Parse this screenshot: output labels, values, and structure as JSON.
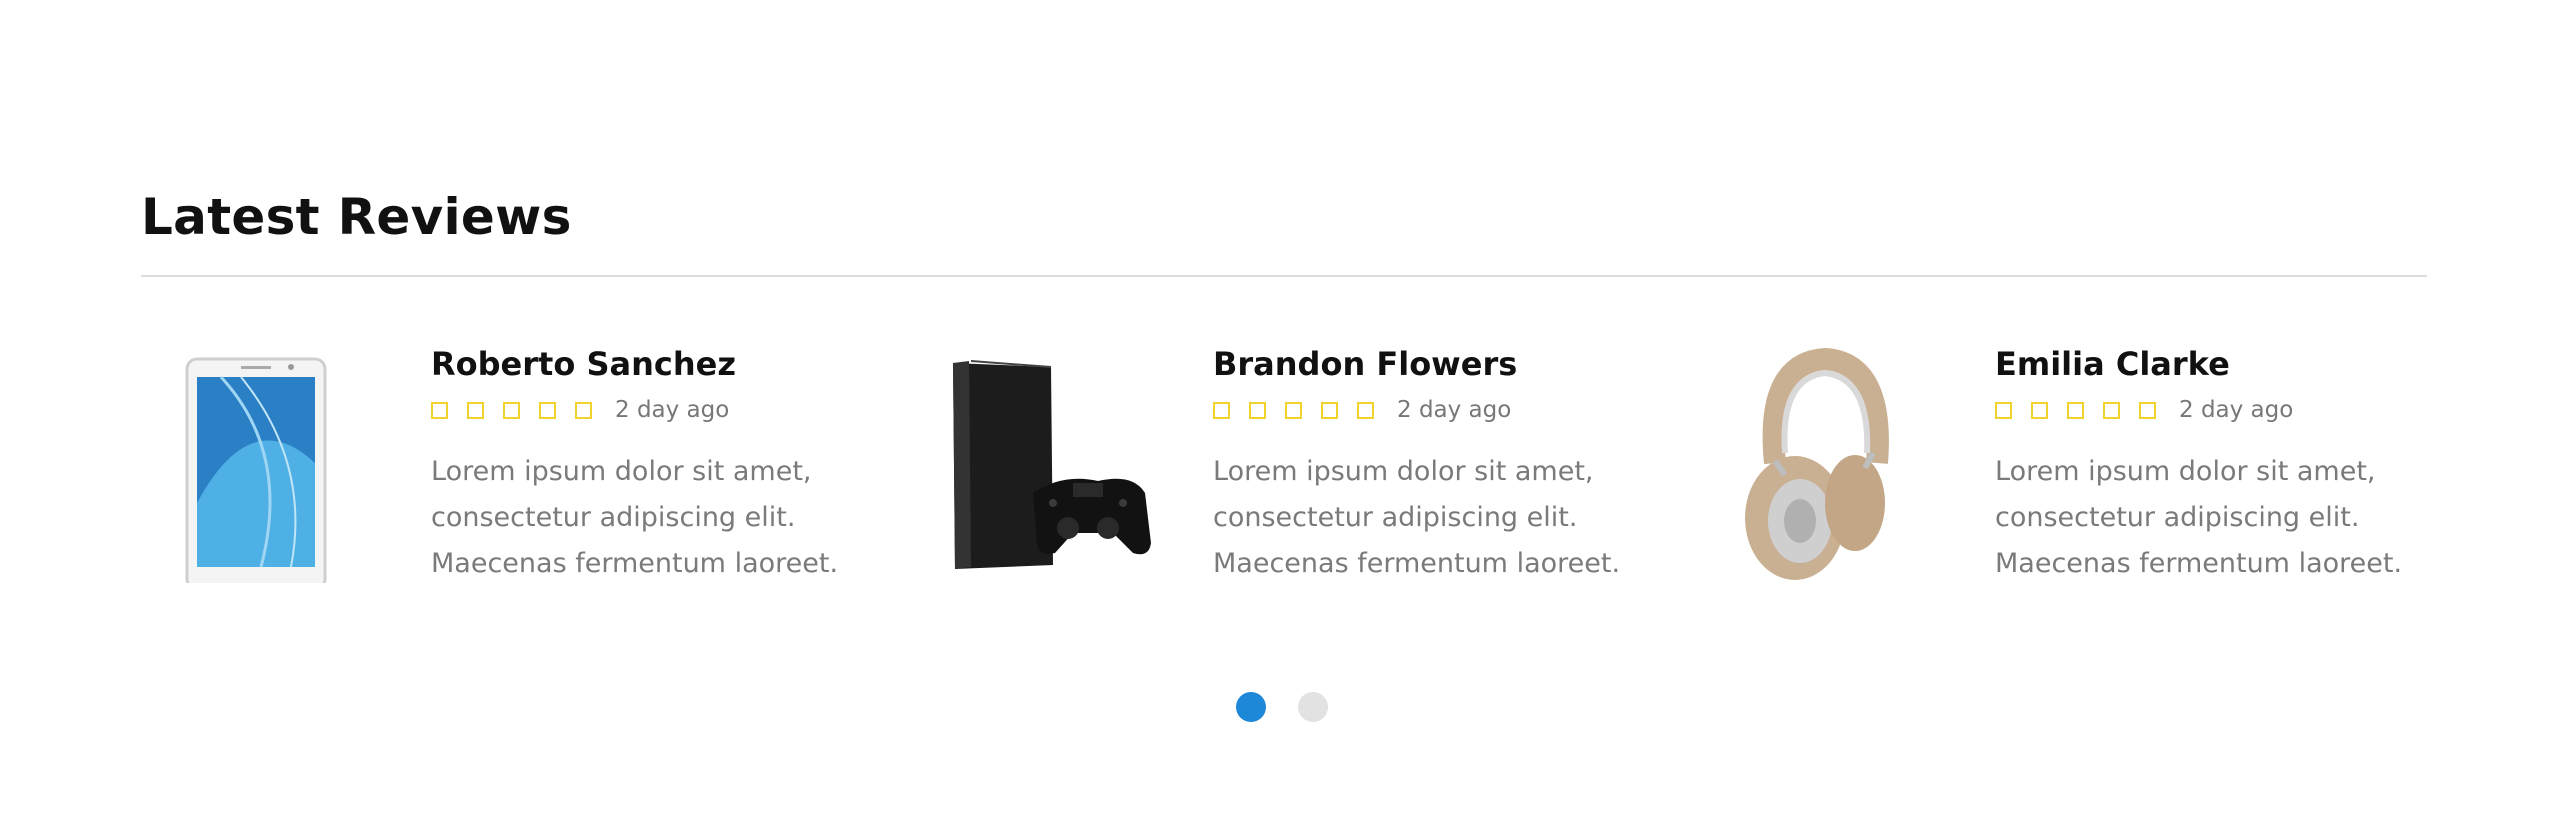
{
  "section": {
    "title": "Latest Reviews"
  },
  "reviews": [
    {
      "name": "Roberto Sanchez",
      "rating_stars": 5,
      "date": "2 day ago",
      "text": "Lorem ipsum dolor sit amet, consectetur adipiscing elit. Maecenas fermentum laoreet.",
      "product_icon": "tablet-icon"
    },
    {
      "name": "Brandon Flowers",
      "rating_stars": 5,
      "date": "2 day ago",
      "text": "Lorem ipsum dolor sit amet, consectetur adipiscing elit. Maecenas fermentum laoreet.",
      "product_icon": "game-console-icon"
    },
    {
      "name": "Emilia Clarke",
      "rating_stars": 5,
      "date": "2 day ago",
      "text": "Lorem ipsum dolor sit amet, consectetur adipiscing elit. Maecenas fermentum laoreet.",
      "product_icon": "headphones-icon"
    }
  ],
  "pagination": {
    "pages": 2,
    "active_page": 1
  },
  "colors": {
    "star": "#f2d22c",
    "dot_active": "#1e88d8",
    "dot_inactive": "#e2e2e2",
    "divider": "#dddddd"
  }
}
